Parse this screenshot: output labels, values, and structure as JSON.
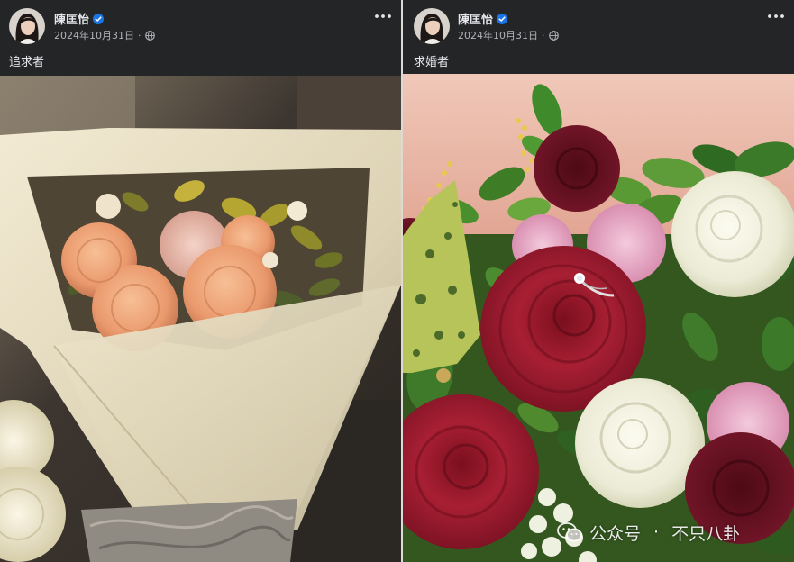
{
  "posts": [
    {
      "author": "陳匡怡",
      "verified_icon": "verified-badge-icon",
      "date": "2024年10月31日",
      "dot": "·",
      "privacy_icon": "globe-icon",
      "menu_icon": "more-options-icon",
      "caption": "追求者"
    },
    {
      "author": "陳匡怡",
      "verified_icon": "verified-badge-icon",
      "date": "2024年10月31日",
      "dot": "·",
      "privacy_icon": "globe-icon",
      "menu_icon": "more-options-icon",
      "caption": "求婚者"
    }
  ],
  "watermark": {
    "icon": "wechat-icon",
    "label": "公众号",
    "separator": "·",
    "account": "不只八卦"
  },
  "colors": {
    "header_background": "#242526",
    "text_primary": "#e4e6eb",
    "text_secondary": "#b0b3b8",
    "verified_badge": "#1b74e4"
  }
}
